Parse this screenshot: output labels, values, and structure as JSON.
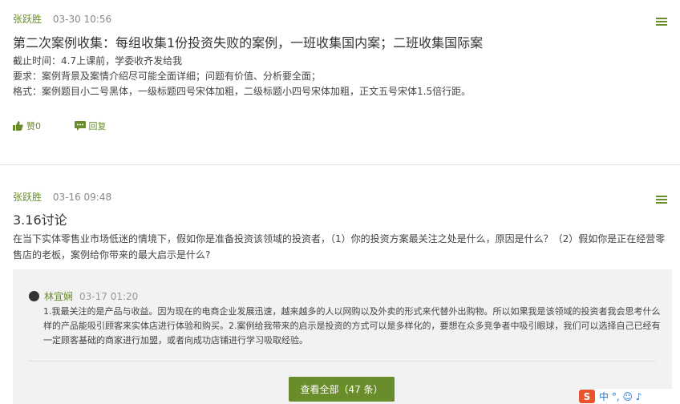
{
  "post1": {
    "author": "张跃胜",
    "time": "03-30 10:56",
    "title": "第二次案例收集：每组收集1份投资失败的案例，一班收集国内案；二班收集国际案",
    "lines": [
      "截止时间：4.7上课前，学委收齐发给我",
      "要求：案例背景及案情介绍尽可能全面详细；问题有价值、分析要全面；",
      "格式：案例题目小二号黑体，一级标题四号宋体加粗，二级标题小四号宋体加粗，正文五号宋体1.5倍行距。"
    ],
    "like_label": "赞0",
    "reply_label": "回复"
  },
  "post2": {
    "author": "张跃胜",
    "time": "03-16 09:48",
    "title": "3.16讨论",
    "body": "在当下实体零售业市场低迷的情境下，假如你是准备投资该领域的投资者，（1）你的投资方案最关注之处是什么，原因是什么？（2）假如你是正在经营零售店的老板，案例给你带来的最大启示是什么?",
    "reply": {
      "author": "林宜娴",
      "time": "03-17 01:20",
      "text": "1.我最关注的是产品与收益。因为现在的电商企业发展迅速，越来越多的人以网购以及外卖的形式来代替外出购物。所以如果我是该领域的投资者我会思考什么样的产品能吸引顾客来实体店进行体验和购买。2.案例给我带来的启示是投资的方式可以是多样化的，要想在众多竞争者中吸引眼球，我们可以选择自己已经有一定顾客基础的商家进行加盟，或者向成功店铺进行学习吸取经验。"
    },
    "view_all_label": "查看全部（47 条）"
  },
  "ime": {
    "logo": "S",
    "text": "中 °, ☺ ♪"
  },
  "colors": {
    "accent": "#6a8d2b",
    "reply_bg": "#f2f2f2"
  }
}
